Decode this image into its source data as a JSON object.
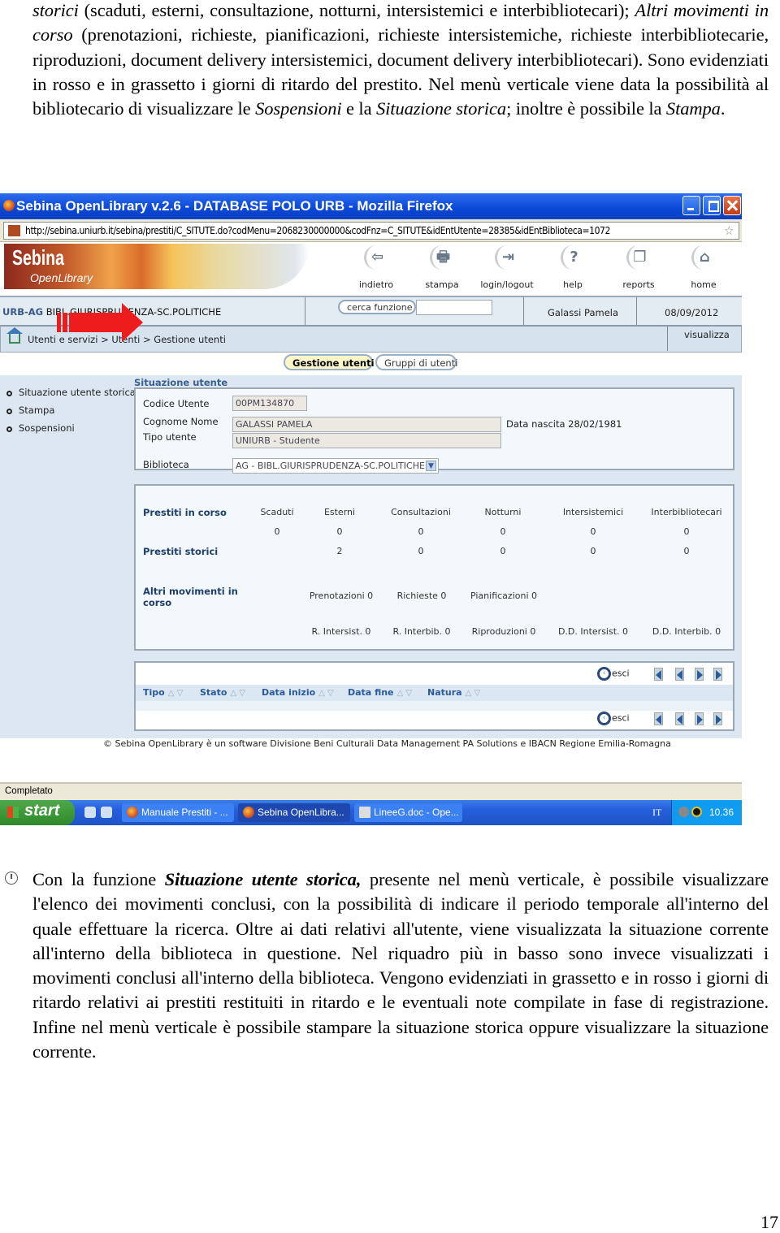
{
  "document": {
    "paragraph1": {
      "s1_italic": "storici",
      "s1": " (scaduti, esterni, consultazione, notturni, intersistemici e interbibliotecari); ",
      "s2_italic": "Altri movimenti in corso",
      "s2": " (prenotazioni, richieste, pianificazioni, richieste intersistemiche, richieste interbibliotecarie, riproduzioni, document delivery intersistemici, document delivery interbibliotecari). Sono evidenziati in rosso e in grassetto i giorni di ritardo del prestito. Nel menù verticale viene data la possibilità al bibliotecario di visualizzare le ",
      "s3_italic": "Sospensioni",
      "s3": " e la ",
      "s4_italic": "Situazione storica",
      "s4": "; inoltre è possibile la ",
      "s5_italic": "Stampa",
      "s5": "."
    },
    "paragraph2": {
      "s1": "Con la funzione ",
      "s2_bold_italic": "Situazione utente storica,",
      "s3": " presente nel menù verticale, è possibile visualizzare l'elenco dei movimenti conclusi, con la possibilità di indicare il periodo temporale all'interno del quale effettuare la ricerca. Oltre ai dati relativi all'utente, viene visualizzata la situazione corrente all'interno della biblioteca in questione. Nel riquadro più in basso sono invece visualizzati i movimenti conclusi all'interno della biblioteca. Vengono evidenziati in grassetto e in rosso i giorni di ritardo relativi ai prestiti restituiti in ritardo e le eventuali note compilate in fase di registrazione. Infine nel menù verticale è possibile stampare la situazione storica oppure visualizzare la situazione corrente."
    },
    "page_number": "17"
  },
  "browser": {
    "title": "Sebina OpenLibrary v.2.6 - DATABASE POLO URB - Mozilla Firefox",
    "url": "http://sebina.uniurb.it/sebina/prestiti/C_SITUTE.do?codMenu=2068230000000&codFnz=C_SITUTE&idEntUtente=28385&idEntBiblioteca=1072",
    "status": "Completato"
  },
  "app": {
    "logo_line1": "Sebina",
    "logo_line2": "OpenLibrary",
    "toolbar": [
      {
        "label": "indietro",
        "icon": "back-arrow-icon",
        "glyph": "⇦"
      },
      {
        "label": "stampa",
        "icon": "printer-icon",
        "glyph": "🖶"
      },
      {
        "label": "login/logout",
        "icon": "door-icon",
        "glyph": "⇥"
      },
      {
        "label": "help",
        "icon": "help-icon",
        "glyph": "?"
      },
      {
        "label": "reports",
        "icon": "documents-icon",
        "glyph": "❐"
      },
      {
        "label": "home",
        "icon": "home-icon",
        "glyph": "⌂"
      }
    ],
    "library_code": "URB-AG",
    "library_name": " BIBL.GIURISPRUDENZA-SC.POLITICHE",
    "cerca_funzione": "cerca funzione",
    "cerca_value": "",
    "user": "Galassi Pamela",
    "date": "08/09/2012",
    "breadcrumb": "Utenti e servizi > Utenti > Gestione utenti",
    "visualizza": "visualizza",
    "tabs": [
      {
        "label": "Gestione utenti",
        "active": true
      },
      {
        "label": "Gruppi di utenti",
        "active": false
      }
    ],
    "side_menu": [
      "Situazione utente storica",
      "Stampa",
      "Sospensioni"
    ],
    "user_section": {
      "title": "Situazione utente",
      "codice_label": "Codice Utente",
      "codice_value": "00PM134870",
      "nome_label": "Cognome Nome",
      "nome_value": "GALASSI PAMELA",
      "tipo_label": "Tipo utente",
      "tipo_value": "UNIURB - Studente",
      "birth": "Data nascita 28/02/1981",
      "biblioteca_label": "Biblioteca",
      "biblioteca_value": "AG - BIBL.GIURISPRUDENZA-SC.POLITICHE"
    },
    "loans": {
      "row_in_corso": "Prestiti in corso",
      "row_storici": "Prestiti storici",
      "row_altri": "Altri movimenti in corso",
      "columns": [
        "Scaduti",
        "Esterni",
        "Consultazioni",
        "Notturni",
        "Intersistemici",
        "Interbibliotecari"
      ],
      "in_corso_values": [
        "0",
        "0",
        "0",
        "0",
        "0",
        "0"
      ],
      "storici_values": [
        "",
        "2",
        "0",
        "0",
        "0",
        "0"
      ],
      "altri_row1": [
        "Prenotazioni 0",
        "Richieste 0",
        "Pianificazioni 0"
      ],
      "altri_row2": [
        "R. Intersist. 0",
        "R. Interbib. 0",
        "Riproduzioni 0",
        "D.D. Intersist. 0",
        "D.D. Interbib. 0"
      ]
    },
    "list": {
      "columns": [
        "Tipo",
        "Stato",
        "Data inizio",
        "Data fine",
        "Natura"
      ],
      "esci": "esci"
    },
    "footer": "© Sebina OpenLibrary è un software   Divisione Beni Culturali Data Management PA Solutions e  IBACN Regione Emilia-Romagna"
  },
  "taskbar": {
    "start": "start",
    "tasks": [
      "Manuale Prestiti - ...",
      "Sebina OpenLibra...",
      "LineeG.doc - Ope..."
    ],
    "lang": "IT",
    "clock": "10.36"
  }
}
